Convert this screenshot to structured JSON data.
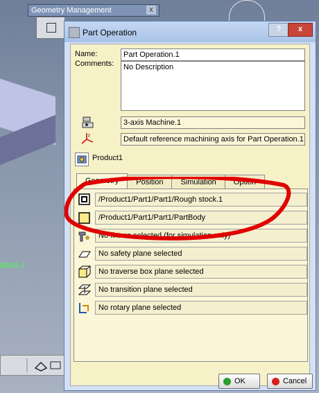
{
  "background": {
    "geometry_panel_title": "Geometry Management",
    "geometry_panel_close": "x",
    "partial_label": "ation.1"
  },
  "dialog": {
    "title": "Part Operation",
    "help_glyph": "?",
    "close_glyph": "x",
    "name_label": "Name:",
    "name_value": "Part Operation.1",
    "comments_label": "Comments:",
    "comments_value": "No Description",
    "machine_value": "3-axis Machine.1",
    "axis_value": "Default reference machining axis for Part Operation.1",
    "product_value": "Product1",
    "tabs": [
      {
        "label": "Geometry",
        "active": true
      },
      {
        "label": "Position",
        "active": false
      },
      {
        "label": "Simulation",
        "active": false
      },
      {
        "label": "Option",
        "active": false
      }
    ],
    "geometry_rows": [
      {
        "icon": "rough-stock-icon",
        "value": "/Product1/Part1/Part1/Rough stock.1"
      },
      {
        "icon": "design-part-icon",
        "value": "/Product1/Part1/Part1/PartBody"
      },
      {
        "icon": "fixture-icon",
        "value": "No fixture selected (for simulation only)"
      },
      {
        "icon": "safety-plane-icon",
        "value": "No safety plane selected"
      },
      {
        "icon": "traverse-box-icon",
        "value": "No traverse box plane selected"
      },
      {
        "icon": "transition-plane-icon",
        "value": "No transition plane selected"
      },
      {
        "icon": "rotary-plane-icon",
        "value": "No rotary plane selected"
      }
    ],
    "ok_label": "OK",
    "cancel_label": "Cancel"
  },
  "colors": {
    "annotation": "#e00000",
    "ok_dot": "#2e9b2e",
    "cancel_dot": "#d62020",
    "panel_bg": "#fbf6d8"
  }
}
